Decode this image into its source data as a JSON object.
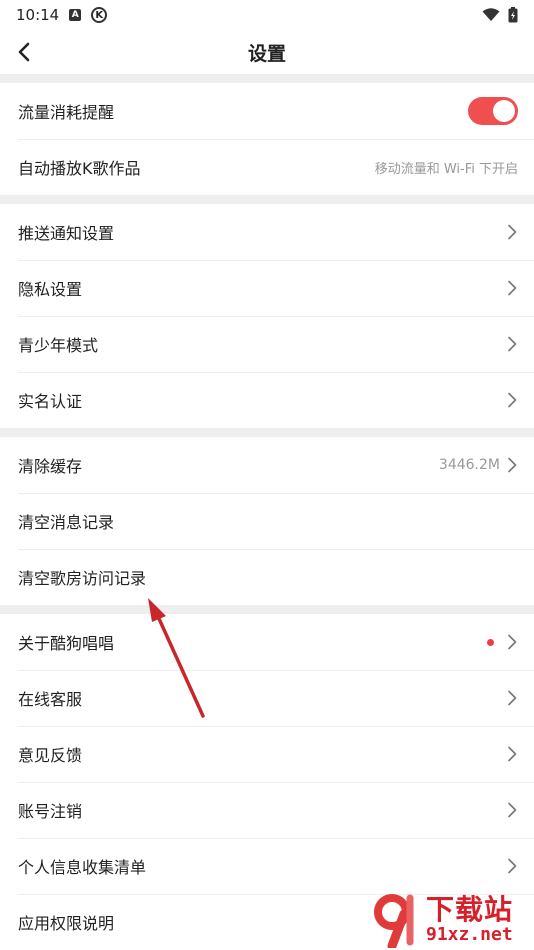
{
  "status_bar": {
    "time": "10:14",
    "icon_a": "A",
    "icon_k": "K"
  },
  "header": {
    "title": "设置"
  },
  "groups": [
    {
      "items": [
        {
          "label": "流量消耗提醒",
          "toggle_on": true
        },
        {
          "label": "自动播放K歌作品",
          "value": "移动流量和 Wi-Fi 下开启"
        }
      ]
    },
    {
      "items": [
        {
          "label": "推送通知设置"
        },
        {
          "label": "隐私设置"
        },
        {
          "label": "青少年模式"
        },
        {
          "label": "实名认证"
        }
      ]
    },
    {
      "items": [
        {
          "label": "清除缓存",
          "value": "3446.2M"
        },
        {
          "label": "清空消息记录"
        },
        {
          "label": "清空歌房访问记录"
        }
      ]
    },
    {
      "items": [
        {
          "label": "关于酷狗唱唱",
          "has_dot": true
        },
        {
          "label": "在线客服"
        },
        {
          "label": "意见反馈"
        },
        {
          "label": "账号注销"
        },
        {
          "label": "个人信息收集清单"
        },
        {
          "label": "应用权限说明"
        }
      ]
    }
  ],
  "watermark": {
    "cn": "下载站",
    "url": "91xz.net"
  },
  "colors": {
    "accent": "#f04f4f",
    "divider": "#eeeeee",
    "annotation": "#c8262b"
  }
}
